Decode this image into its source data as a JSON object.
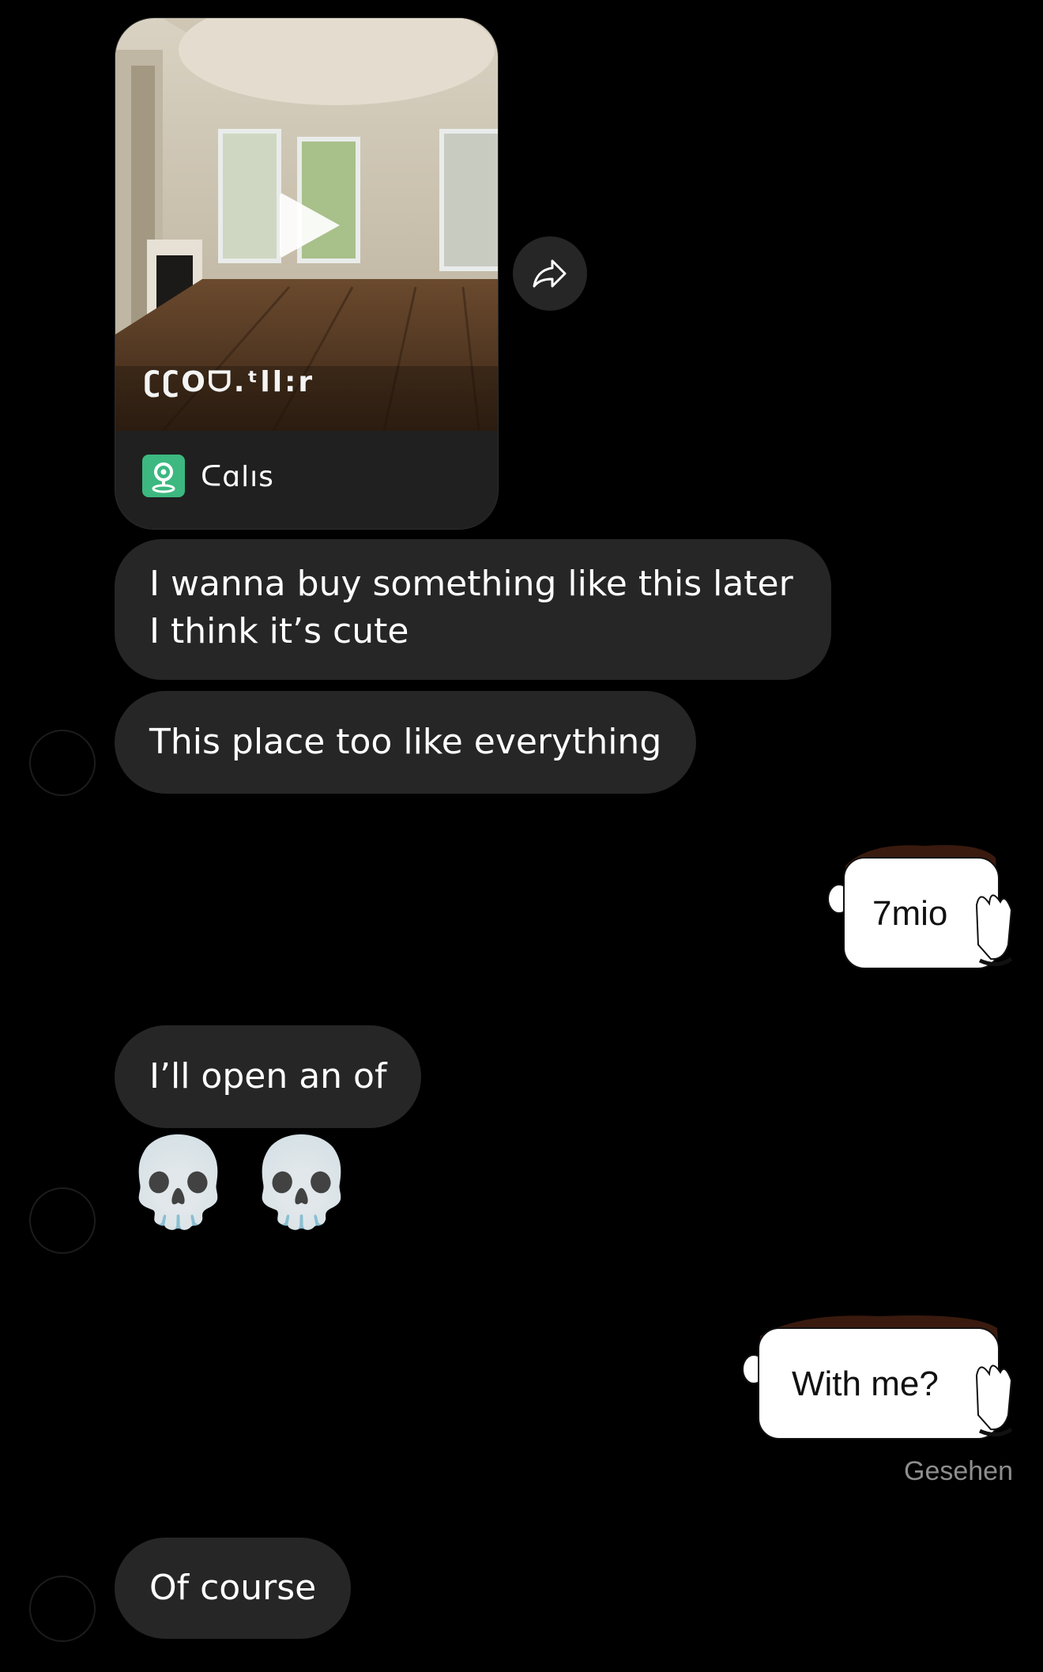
{
  "video_card": {
    "caption": "ʗʗOᗜ.ᵗll:r",
    "location_label": "ᑕɑlıs"
  },
  "messages": {
    "incoming_1": "I wanna buy something like this later I think it’s cute",
    "incoming_2": "This place too like everything",
    "outgoing_1": "7mio",
    "incoming_3": "I’ll open an of",
    "emoji_reaction": [
      "💀",
      "💀"
    ],
    "outgoing_2": "With me?",
    "seen_status": "Gesehen",
    "incoming_4": "Of course"
  },
  "colors": {
    "background": "#000000",
    "incoming_bubble": "#262626",
    "seen_text": "#8e8e8e",
    "location_icon": "#3cb880"
  }
}
